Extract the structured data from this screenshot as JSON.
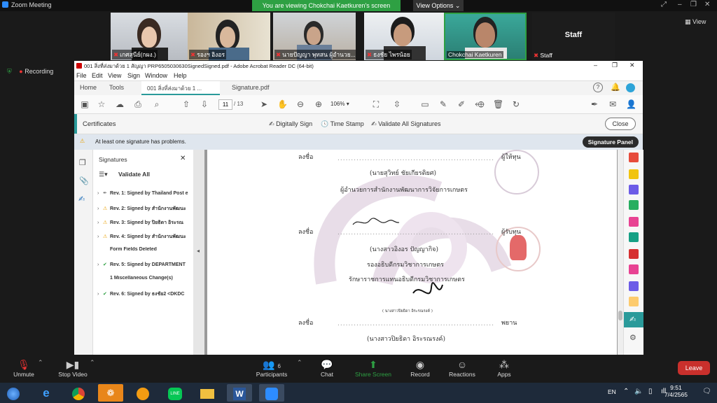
{
  "zoom": {
    "window_title": "Zoom Meeting",
    "viewing_banner": "You are viewing Chokchai Kaetkuren's screen",
    "view_options": "View Options",
    "view_button": "View",
    "recording": "Recording",
    "participants": [
      {
        "name": "เกศสุนีย์(กผง.)"
      },
      {
        "name": "รองฯ อิงอร"
      },
      {
        "name": "นายปัญญา พุทสน ผู้อำนวย..."
      },
      {
        "name": "ธงชัย ไพรน้อย"
      },
      {
        "name": "Chokchai Kaetkuren"
      },
      {
        "name": "Staff"
      }
    ],
    "staff_tile_label": "Staff",
    "bottom_bar": {
      "unmute": "Unmute",
      "stop_video": "Stop Video",
      "participants": "Participants",
      "participants_count": "6",
      "chat": "Chat",
      "share_screen": "Share Screen",
      "record": "Record",
      "reactions": "Reactions",
      "apps": "Apps",
      "leave": "Leave"
    }
  },
  "acrobat": {
    "title": "001 สิ่งที่ส่งมาด้วย 1 สัญญา PRP6505030630SignedSigned.pdf - Adobe Acrobat Reader DC (64-bit)",
    "menu": [
      "File",
      "Edit",
      "View",
      "Sign",
      "Window",
      "Help"
    ],
    "tabs": {
      "home": "Home",
      "tools": "Tools",
      "doc1": "001 สิ่งที่ส่งมาด้วย 1 ...",
      "doc2": "Signature.pdf"
    },
    "page_current": "11",
    "page_total": "/ 13",
    "zoom_level": "106%",
    "certificates": {
      "label": "Certificates",
      "digitally_sign": "Digitally Sign",
      "time_stamp": "Time Stamp",
      "validate_all": "Validate All Signatures",
      "close": "Close"
    },
    "warning": "At least one signature has problems.",
    "signature_panel_button": "Signature Panel",
    "signatures_panel": {
      "title": "Signatures",
      "validate_all": "Validate All",
      "items": [
        {
          "label": "Rev. 1: Signed by Thailand Post e",
          "status": "pen"
        },
        {
          "label": "Rev. 2: Signed by สำนักงานพัฒนะ",
          "status": "warn"
        },
        {
          "label": "Rev. 3: Signed by ปิยธิดา อิระรณ",
          "status": "warn"
        },
        {
          "label": "Rev. 4: Signed by สำนักงานพัฒนะ",
          "status": "warn"
        },
        {
          "label": "Form Fields Deleted",
          "status": "none"
        },
        {
          "label": "Rev. 5: Signed by DEPARTMENT",
          "status": "ok"
        },
        {
          "label": "1 Miscellaneous Change(s)",
          "status": "none"
        },
        {
          "label": "Rev. 6: Signed by ธงชัย2 <DKDC",
          "status": "ok"
        }
      ]
    },
    "document": {
      "sign_label_1": "ลงชื่อ",
      "role_1": "ผู้ให้ทุน",
      "name_1": "(นายสุวิทย์  ชัยเกียรติยศ)",
      "title_1": "ผู้อำนวยการสำนักงานพัฒนาการวิจัยการเกษตร",
      "sign_label_2": "ลงชื่อ",
      "role_2": "ผู้รับทุน",
      "name_2": "(นางสาวอิงอร  ปัญญากิจ)",
      "title_2": "รองอธิบดีกรมวิชาการเกษตร",
      "title_2b": "รักษาราชการแทนอธิบดีกรมวิชาการเกษตร",
      "small_name_3": "( นางสาวปิยธิดา  อิระรณรงค์ )",
      "sign_label_3": "ลงชื่อ",
      "role_3": "พยาน",
      "name_3": "(นางสาวปิยธิดา  อิระรณรงค์)"
    }
  },
  "taskbar": {
    "lang": "EN",
    "time": "9:51",
    "date": "7/4/2565"
  },
  "colors": {
    "zoom_green": "#2ea043",
    "leave_red": "#c9302c",
    "acrobat_teal": "#2a9a9a"
  }
}
